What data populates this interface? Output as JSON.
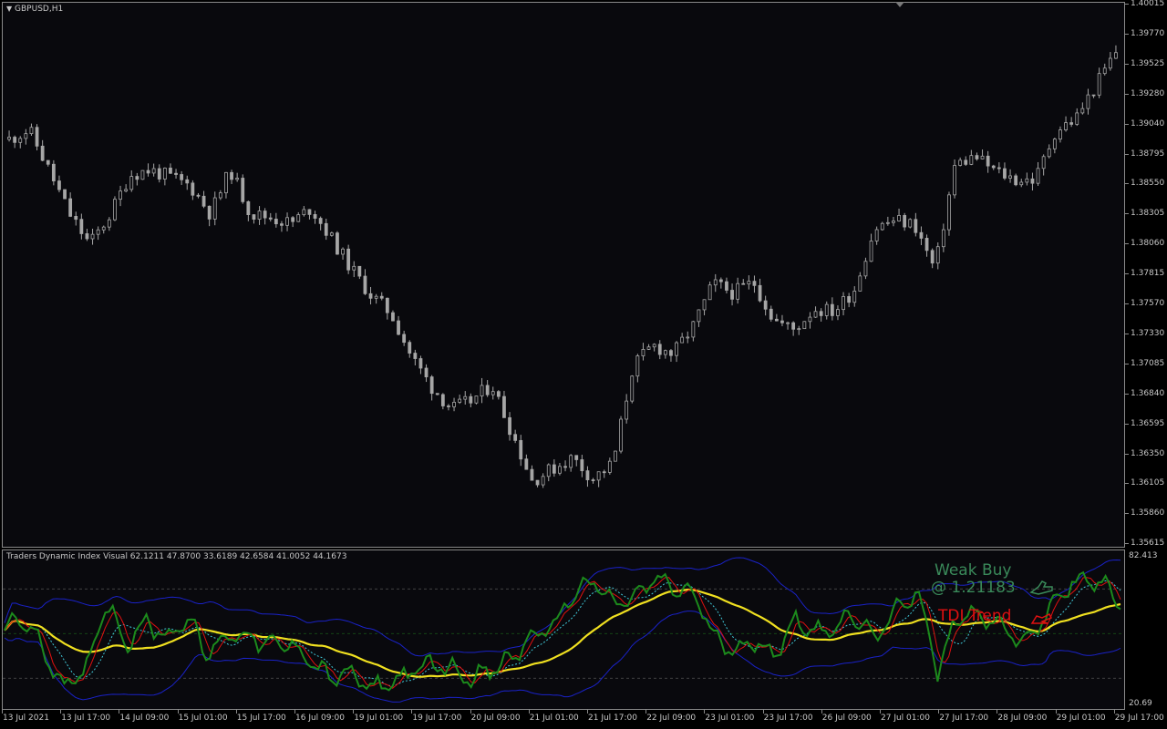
{
  "symbol_label": "GBPUSD,H1",
  "indicator_label": "Traders Dynamic Index Visual 62.1211 47.8700 33.6189 42.6584 41.0052 44.1673",
  "price_axis": [
    "1.40015",
    "1.39770",
    "1.39525",
    "1.39280",
    "1.39040",
    "1.38795",
    "1.38550",
    "1.38305",
    "1.38060",
    "1.37815",
    "1.37570",
    "1.37330",
    "1.37085",
    "1.36840",
    "1.36595",
    "1.36350",
    "1.36105",
    "1.35860",
    "1.35615"
  ],
  "indicator_axis": {
    "top": "82.413",
    "bottom": "20.69"
  },
  "time_axis": [
    "13 Jul 2021",
    "13 Jul 17:00",
    "14 Jul 09:00",
    "15 Jul 01:00",
    "15 Jul 17:00",
    "16 Jul 09:00",
    "19 Jul 01:00",
    "19 Jul 17:00",
    "20 Jul 09:00",
    "21 Jul 01:00",
    "21 Jul 17:00",
    "22 Jul 09:00",
    "23 Jul 01:00",
    "23 Jul 17:00",
    "26 Jul 09:00",
    "27 Jul 01:00",
    "27 Jul 17:00",
    "28 Jul 09:00",
    "29 Jul 01:00",
    "29 Jul 17:00"
  ],
  "signal": {
    "line1": "Weak Buy",
    "line2": "@ 1.21183",
    "trend_label": "TDI Trend"
  },
  "colors": {
    "background": "#09090d",
    "candle": "#a6a6a6",
    "rsi": "#1c8a1c",
    "signal_line": "#e01010",
    "market_base": "#f0e020",
    "bands": "#1a22c8",
    "fast_ma": "#40c8d8",
    "text": "#c8c8c8",
    "weak_buy": "#3a8a5a",
    "trend": "#e01010"
  },
  "chart_data": {
    "type": "candlestick",
    "title": "GBPUSD,H1",
    "ylim": [
      1.35615,
      1.40015
    ],
    "price_path": [
      1.3891,
      1.3899,
      1.3865,
      1.383,
      1.3805,
      1.3829,
      1.3862,
      1.3866,
      1.386,
      1.3853,
      1.383,
      1.3866,
      1.383,
      1.3827,
      1.3822,
      1.3835,
      1.381,
      1.3785,
      1.3763,
      1.3748,
      1.3713,
      1.3688,
      1.367,
      1.3677,
      1.369,
      1.365,
      1.3611,
      1.3621,
      1.363,
      1.3613,
      1.3625,
      1.3705,
      1.3722,
      1.3715,
      1.3738,
      1.3773,
      1.3765,
      1.3774,
      1.3743,
      1.3735,
      1.3752,
      1.375,
      1.3768,
      1.3818,
      1.3825,
      1.3821,
      1.3784,
      1.387,
      1.3877,
      1.3865,
      1.3858,
      1.3858,
      1.3898,
      1.3908,
      1.3935,
      1.3963
    ],
    "indicator": {
      "name": "Traders Dynamic Index Visual",
      "values": [
        62.1211,
        47.87,
        33.6189,
        42.6584,
        41.0052,
        44.1673
      ],
      "ylim": [
        20.69,
        82.413
      ],
      "rsi_path": [
        52,
        56,
        42,
        28,
        35,
        63,
        46,
        55,
        48,
        57,
        41,
        50,
        49,
        45,
        46,
        40,
        32,
        34,
        28,
        30,
        34,
        38,
        36,
        32,
        35,
        40,
        49,
        52,
        66,
        71,
        62,
        64,
        72,
        68,
        66,
        48,
        44,
        46,
        42,
        56,
        50,
        54,
        56,
        48,
        60,
        68,
        34,
        58,
        58,
        54,
        46,
        53,
        66,
        72,
        70,
        64
      ]
    }
  }
}
